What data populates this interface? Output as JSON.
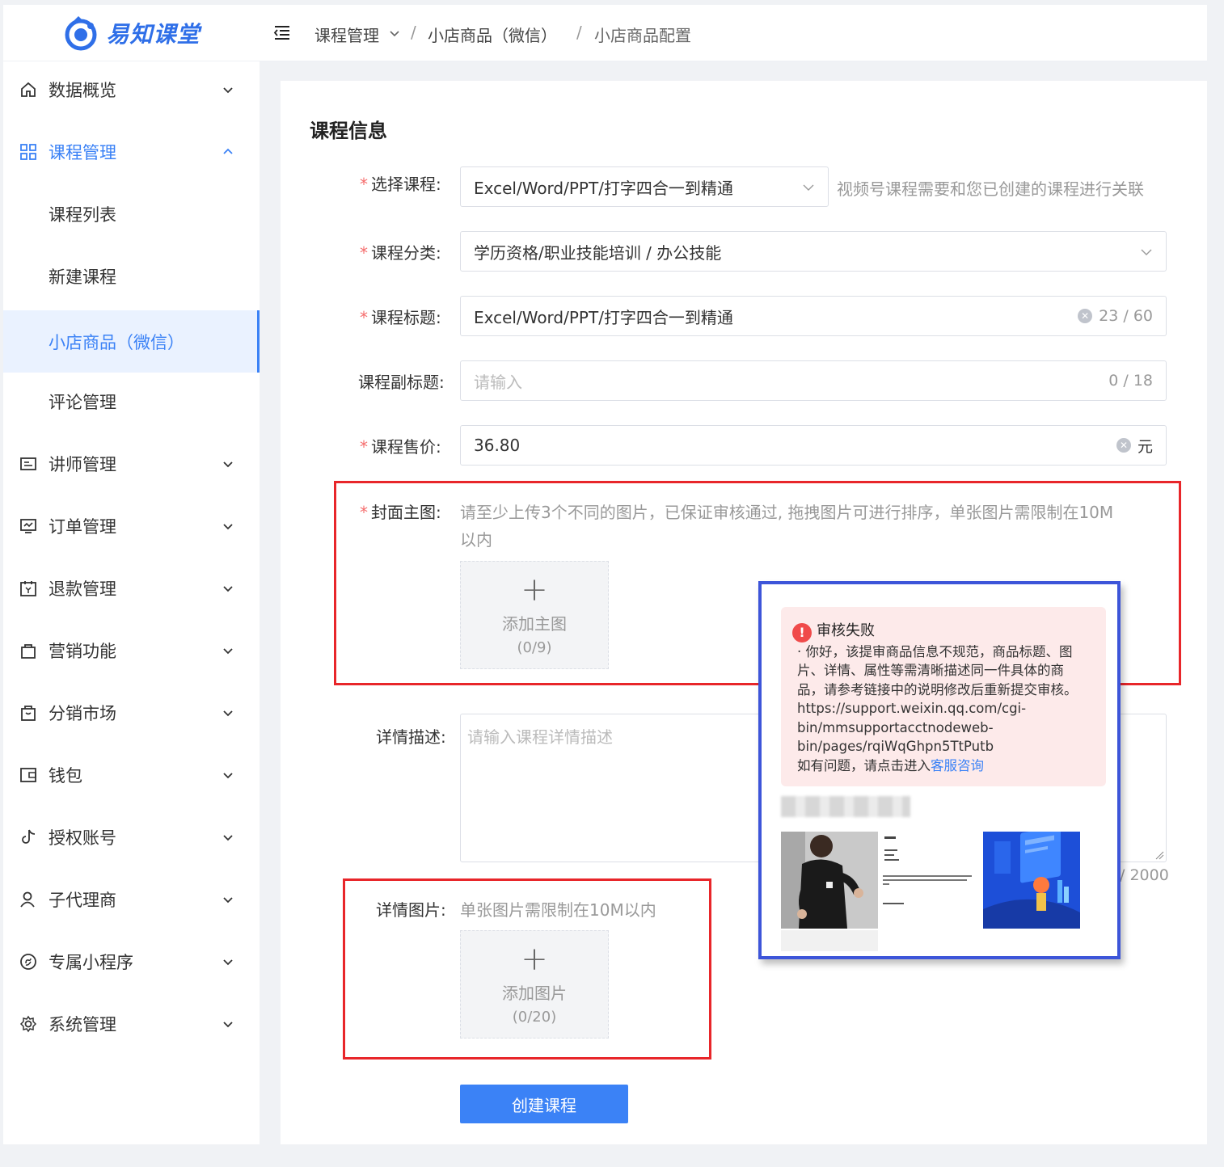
{
  "app": {
    "logo_text": "易知课堂"
  },
  "sidebar": {
    "items": [
      {
        "label": "数据概览",
        "icon": "home-icon"
      },
      {
        "label": "课程管理",
        "icon": "grid-icon"
      },
      {
        "label": "课程列表"
      },
      {
        "label": "新建课程"
      },
      {
        "label": "小店商品（微信）"
      },
      {
        "label": "评论管理"
      },
      {
        "label": "讲师管理",
        "icon": "id-card-icon"
      },
      {
        "label": "订单管理",
        "icon": "order-icon"
      },
      {
        "label": "退款管理",
        "icon": "refund-icon"
      },
      {
        "label": "营销功能",
        "icon": "bag-icon"
      },
      {
        "label": "分销市场",
        "icon": "shop-bag-icon"
      },
      {
        "label": "钱包",
        "icon": "wallet-icon"
      },
      {
        "label": "授权账号",
        "icon": "tiktok-icon"
      },
      {
        "label": "子代理商",
        "icon": "user-icon"
      },
      {
        "label": "专属小程序",
        "icon": "mini-program-icon"
      },
      {
        "label": "系统管理",
        "icon": "gear-icon"
      }
    ]
  },
  "breadcrumb": {
    "items": [
      "课程管理",
      "小店商品（微信）",
      "小店商品配置"
    ],
    "separator": "/"
  },
  "form": {
    "section_title": "课程信息",
    "course": {
      "label": "选择课程:",
      "value": "Excel/Word/PPT/打字四合一到精通",
      "hint": "视频号课程需要和您已创建的课程进行关联"
    },
    "category": {
      "label": "课程分类:",
      "value": "学历资格/职业技能培训 / 办公技能"
    },
    "title": {
      "label": "课程标题:",
      "value": "Excel/Word/PPT/打字四合一到精通",
      "count": "23 / 60"
    },
    "subtitle": {
      "label": "课程副标题:",
      "placeholder": "请输入",
      "count": "0 / 18"
    },
    "price": {
      "label": "课程售价:",
      "value": "36.80",
      "unit": "元"
    },
    "cover": {
      "label": "封面主图:",
      "hint": "请至少上传3个不同的图片，已保证审核通过, 拖拽图片可进行排序，单张图片需限制在10M",
      "hint_line2": "以内",
      "upload_label": "添加主图",
      "upload_count": "(0/9)"
    },
    "description": {
      "label": "详情描述:",
      "placeholder": "请输入课程详情描述",
      "count": "/ 2000"
    },
    "detail_images": {
      "label": "详情图片:",
      "hint": "单张图片需限制在10M以内",
      "upload_label": "添加图片",
      "upload_count": "(0/20)"
    },
    "submit_label": "创建课程"
  },
  "popup": {
    "title": "审核失败",
    "line1": "· 你好，该提审商品信息不规范，商品标题、图",
    "line2": "片、详情、属性等需清晰描述同一件具体的商",
    "line3": "品，请参考链接中的说明修改后重新提交审核。",
    "line4": "https://support.weixin.qq.com/cgi-",
    "line5": "bin/mmsupportacctnodeweb-",
    "line6": "bin/pages/rqiWqGhpn5TtPutb",
    "line7_prefix": "如有问题，请点击进入",
    "line7_link": "客服咨询"
  },
  "colors": {
    "primary": "#3b82f6",
    "danger": "#e8262a",
    "popup_border": "#3d55d9",
    "alert_bg": "#fdeaea"
  }
}
